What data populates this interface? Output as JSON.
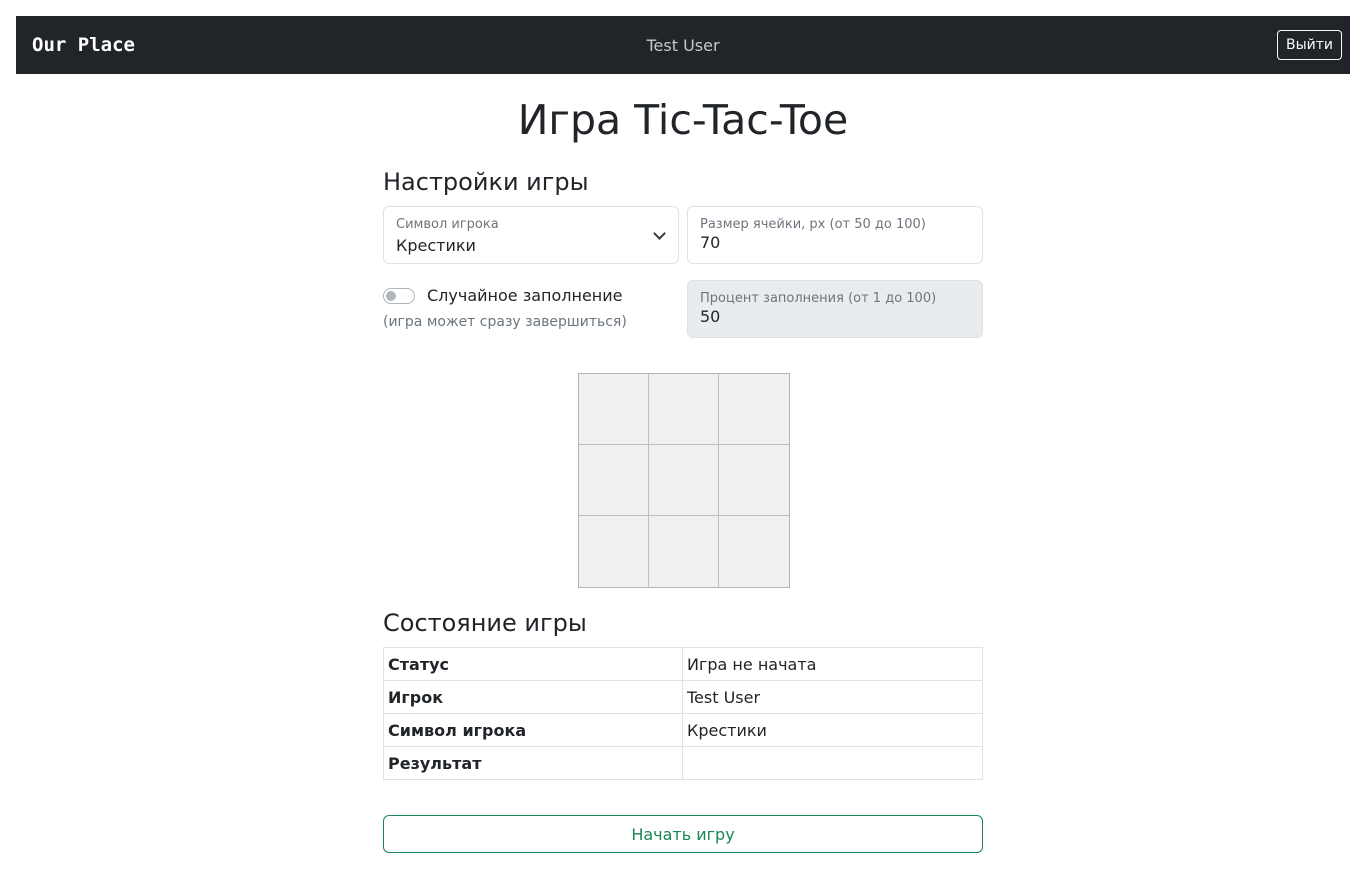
{
  "navbar": {
    "brand": "Our Place",
    "user": "Test User",
    "logout_label": "Выйти"
  },
  "page": {
    "title": "Игра Tic-Tac-Toe"
  },
  "settings": {
    "heading": "Настройки игры",
    "symbol": {
      "label": "Символ игрока",
      "value": "Крестики"
    },
    "cell_size": {
      "label": "Размер ячейки, px (от 50 до 100)",
      "value": "70"
    },
    "random_fill": {
      "label": "Случайное заполнение",
      "hint": "(игра может сразу завершиться)",
      "checked": false
    },
    "fill_percent": {
      "label": "Процент заполнения (от 1 до 100)",
      "value": "50",
      "disabled": true
    }
  },
  "board": {
    "rows": 3,
    "cols": 3,
    "cells": [
      "",
      "",
      "",
      "",
      "",
      "",
      "",
      "",
      ""
    ]
  },
  "state": {
    "heading": "Состояние игры",
    "rows": [
      {
        "key": "Статус",
        "value": "Игра не начата"
      },
      {
        "key": "Игрок",
        "value": "Test User"
      },
      {
        "key": "Символ игрока",
        "value": "Крестики"
      },
      {
        "key": "Результат",
        "value": ""
      }
    ]
  },
  "actions": {
    "start_label": "Начать игру"
  },
  "colors": {
    "navbar_bg": "#212529",
    "success": "#198754",
    "cell_bg": "#f0f0f0"
  }
}
